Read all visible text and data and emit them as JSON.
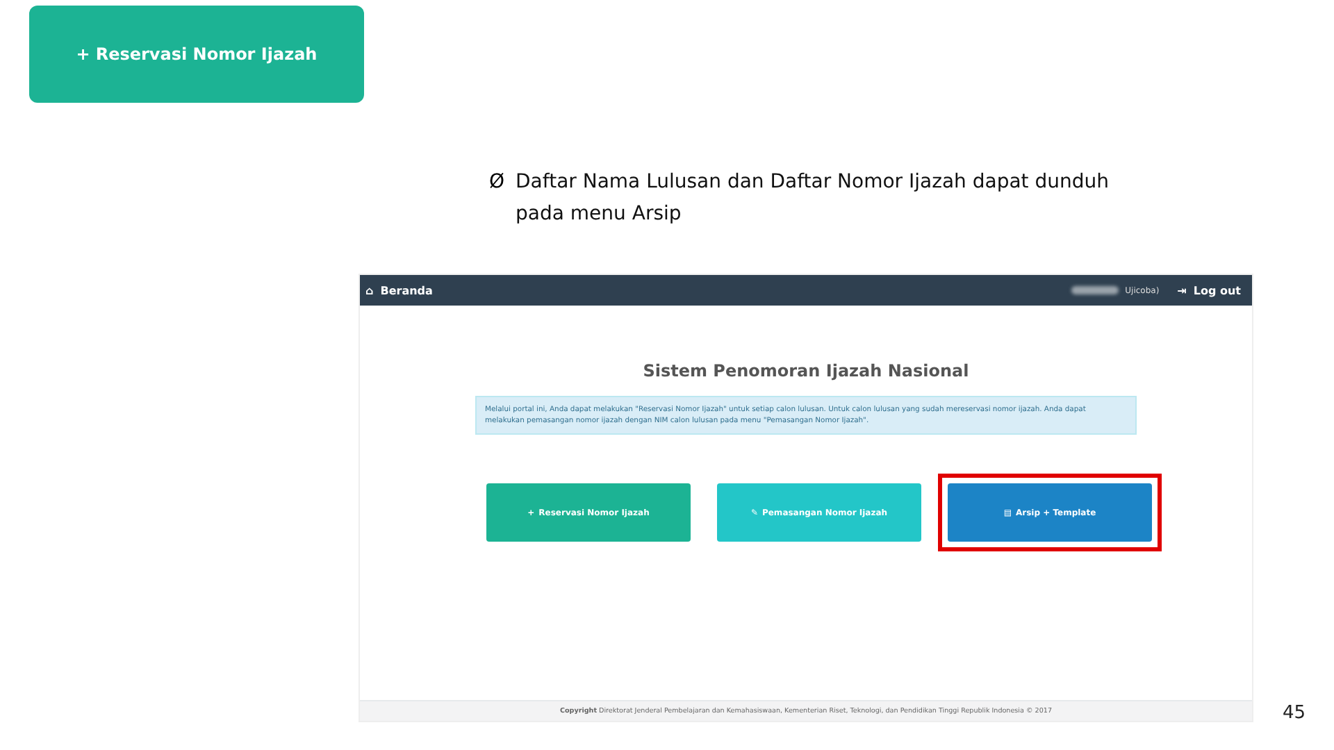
{
  "top_button": {
    "icon": "+",
    "label": "Reservasi Nomor Ijazah"
  },
  "bullet": {
    "marker": "Ø",
    "text": "Daftar Nama Lulusan dan Daftar Nomor Ijazah dapat dunduh pada menu Arsip"
  },
  "screenshot": {
    "navbar": {
      "icon": "⌂",
      "title": "Beranda",
      "user": "Ujicoba)",
      "logout_icon": "⇥",
      "logout": "Log out"
    },
    "heading": "Sistem Penomoran Ijazah Nasional",
    "info": "Melalui portal ini, Anda dapat melakukan \"Reservasi Nomor Ijazah\" untuk setiap calon lulusan. Untuk calon lulusan yang sudah mereservasi nomor ijazah. Anda dapat melakukan pemasangan nomor ijazah dengan NIM calon lulusan pada menu \"Pemasangan Nomor Ijazah\".",
    "buttons": [
      {
        "icon": "+",
        "label": "Reservasi Nomor Ijazah",
        "color": "#1cb394",
        "selected": false
      },
      {
        "icon": "✎",
        "label": "Pemasangan Nomor Ijazah",
        "color": "#23c6c8",
        "selected": false
      },
      {
        "icon": "▤",
        "label": "Arsip + Template",
        "color": "#1c84c6",
        "selected": true
      }
    ],
    "footer": {
      "bold": "Copyright",
      "text": "Direktorat Jenderal Pembelajaran dan Kemahasiswaan, Kementerian Riset, Teknologi, dan Pendidikan Tinggi Republik Indonesia © 2017"
    }
  },
  "page_number": "45"
}
